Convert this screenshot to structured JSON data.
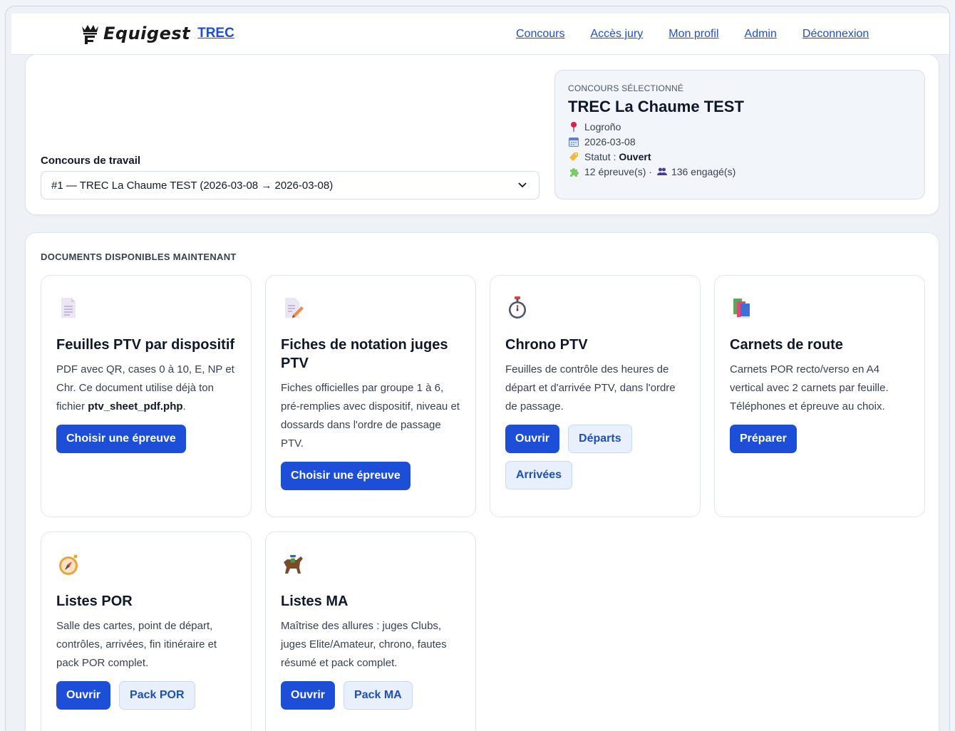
{
  "header": {
    "logo_text": "Equigest",
    "brand_link": "TREC",
    "nav": [
      "Concours",
      "Accès jury",
      "Mon profil",
      "Admin",
      "Déconnexion"
    ]
  },
  "workspace": {
    "field_label": "Concours de travail",
    "select_value": "#1 — TREC La Chaume TEST (2026-03-08 → 2026-03-08)"
  },
  "selected": {
    "kicker": "CONCOURS SÉLECTIONNÉ",
    "title": "TREC La Chaume TEST",
    "location": "Logroño",
    "date": "2026-03-08",
    "status_label": "Statut :",
    "status_value": "Ouvert",
    "epreuves": "12 épreuve(s) ·",
    "engages": "136 engagé(s)"
  },
  "documents": {
    "section_title": "DOCUMENTS DISPONIBLES MAINTENANT",
    "cards": [
      {
        "icon": "document-icon",
        "title": "Feuilles PTV par dispositif",
        "desc_before": "PDF avec QR, cases 0 à 10, E, NP et Chr. Ce document utilise déjà ton fichier",
        "desc_bold": "ptv_sheet_pdf.php",
        "desc_after": ".",
        "buttons": [
          "Choisir une épreuve"
        ]
      },
      {
        "icon": "memo-pencil-icon",
        "title": "Fiches de notation juges PTV",
        "desc": "Fiches officielles par groupe 1 à 6, pré-remplies avec dispositif, niveau et dossards dans l'ordre de passage PTV.",
        "buttons": [
          "Choisir une épreuve"
        ]
      },
      {
        "icon": "stopwatch-icon",
        "title": "Chrono PTV",
        "desc": "Feuilles de contrôle des heures de départ et d'arrivée PTV, dans l'ordre de passage.",
        "buttons": [
          "Ouvrir",
          "Départs",
          "Arrivées"
        ]
      },
      {
        "icon": "books-icon",
        "title": "Carnets de route",
        "desc": "Carnets POR recto/verso en A4 vertical avec 2 carnets par feuille. Téléphones et épreuve au choix.",
        "buttons": [
          "Préparer"
        ]
      },
      {
        "icon": "compass-icon",
        "title": "Listes POR",
        "desc": "Salle des cartes, point de départ, contrôles, arrivées, fin itinéraire et pack POR complet.",
        "buttons": [
          "Ouvrir",
          "Pack POR"
        ]
      },
      {
        "icon": "horse-racing-icon",
        "title": "Listes MA",
        "desc": "Maîtrise des allures : juges Clubs, juges Elite/Amateur, chrono, fautes résumé et pack complet.",
        "buttons": [
          "Ouvrir",
          "Pack MA"
        ]
      }
    ]
  },
  "colors": {
    "primary": "#1d4ed8",
    "soft_button": "#e8f0fd",
    "selected_card_bg": "#f2f6fb"
  }
}
